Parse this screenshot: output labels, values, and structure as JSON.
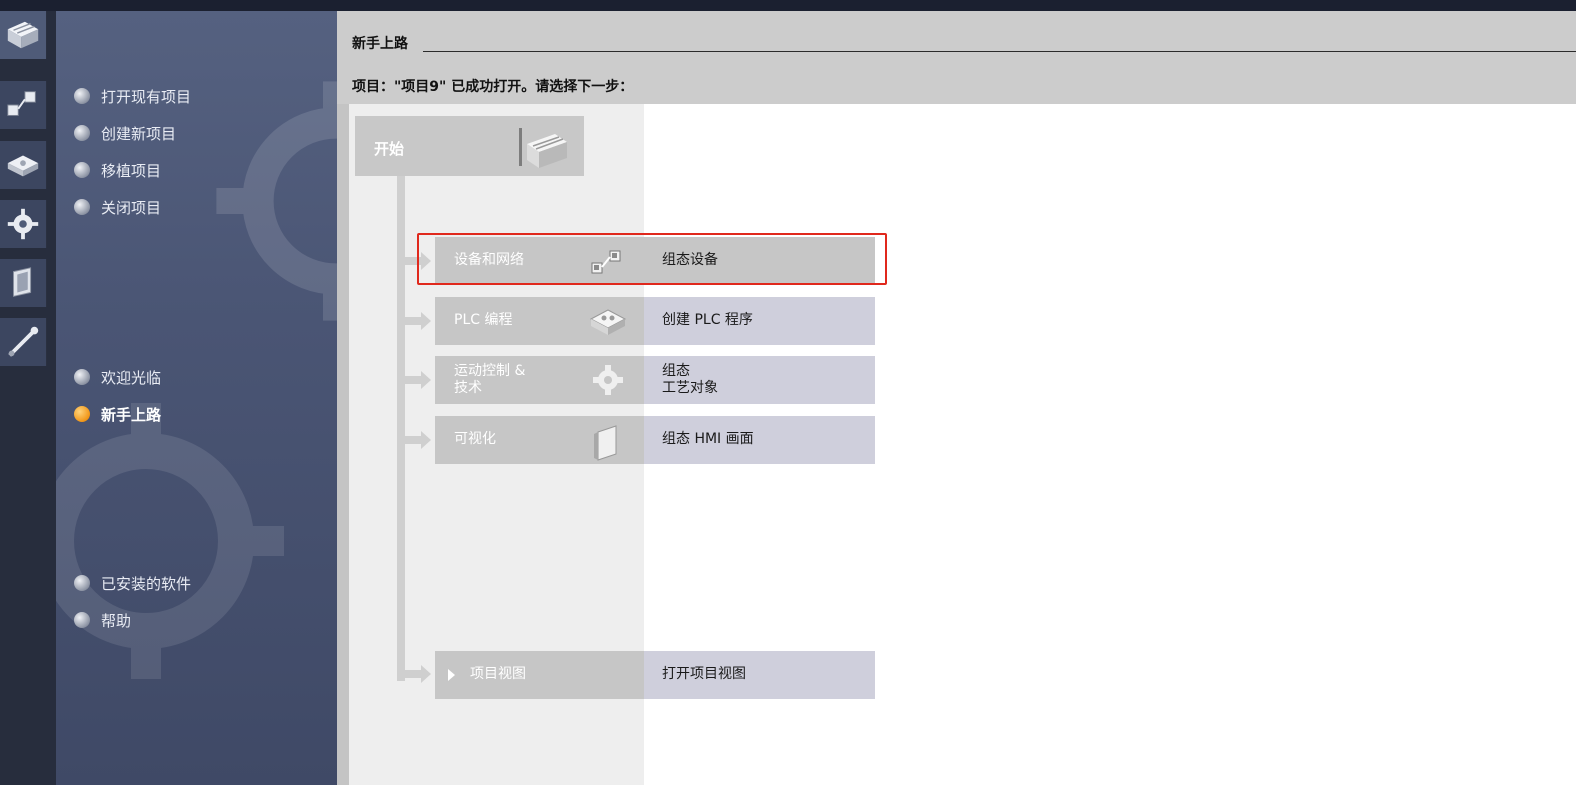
{
  "nav": {
    "items": [
      {
        "label": "打开现有项目",
        "active": false
      },
      {
        "label": "创建新项目",
        "active": false
      },
      {
        "label": "移植项目",
        "active": false
      },
      {
        "label": "关闭项目",
        "active": false
      },
      {
        "label": "欢迎光临",
        "active": false
      },
      {
        "label": "新手上路",
        "active": true
      },
      {
        "label": "已安装的软件",
        "active": false
      },
      {
        "label": "帮助",
        "active": false
      }
    ]
  },
  "rail": {
    "icons": [
      "start-icon",
      "devices-networks-icon",
      "plc-programming-icon",
      "motion-control-icon",
      "visualization-icon",
      "online-diagnostics-icon"
    ]
  },
  "header": {
    "title": "新手上路",
    "status": "项目：\"项目9\" 已成功打开。请选择下一步："
  },
  "start": {
    "label": "开始"
  },
  "rows": [
    {
      "label": "设备和网络",
      "action": "组态设备",
      "icon": "devices-networks-icon",
      "active": true
    },
    {
      "label": "PLC 编程",
      "action": "创建 PLC 程序",
      "icon": "plc-programming-icon",
      "active": false
    },
    {
      "label": "运动控制 &\n技术",
      "action": "组态\n工艺对象",
      "icon": "motion-control-icon",
      "active": false
    },
    {
      "label": "可视化",
      "action": "组态 HMI 画面",
      "icon": "visualization-icon",
      "active": false
    },
    {
      "label": "项目视图",
      "action": "打开项目视图",
      "icon": "caret-right-icon",
      "active": false
    }
  ],
  "colors": {
    "highlight": "#e0281c",
    "active_dot": "#f29a1e",
    "nav_bg": "#4a5574",
    "header_bg": "#cccccc"
  }
}
